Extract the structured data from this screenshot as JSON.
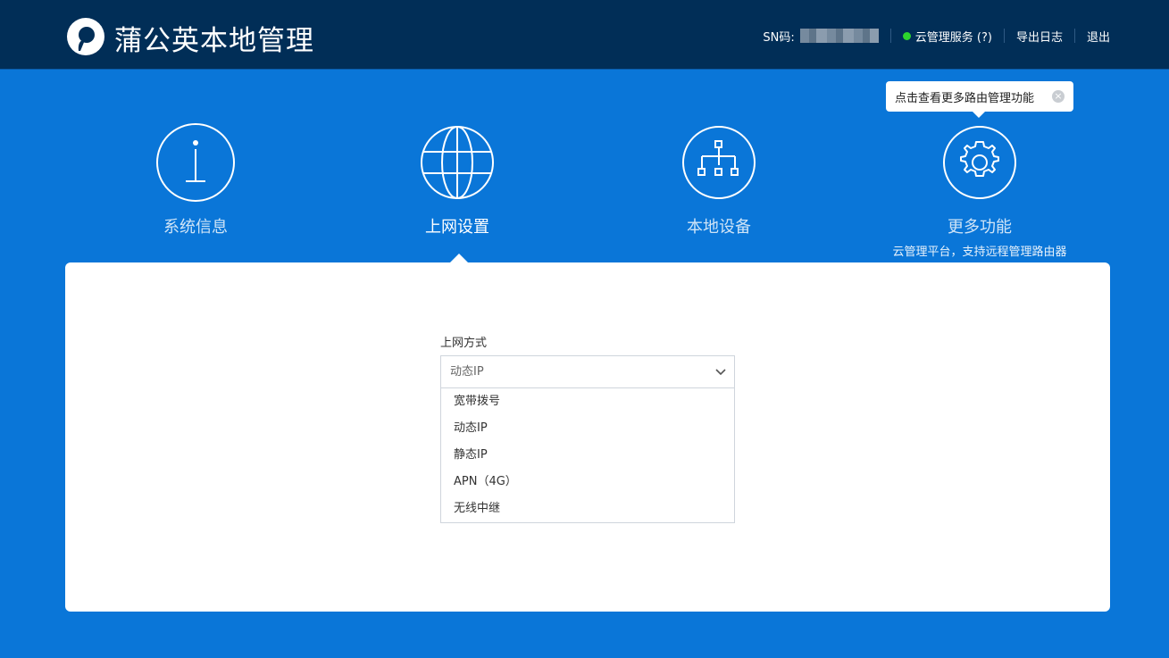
{
  "header": {
    "brand": "蒲公英本地管理",
    "sn_label": "SN码:",
    "cloud_service": "云管理服务 (?)",
    "export_log": "导出日志",
    "logout": "退出",
    "status_color": "#2dd42d"
  },
  "tooltip": {
    "text": "点击查看更多路由管理功能",
    "close_icon": "close-icon"
  },
  "nav": {
    "items": [
      {
        "label": "系统信息",
        "icon": "info-icon"
      },
      {
        "label": "上网设置",
        "icon": "globe-icon",
        "active": true
      },
      {
        "label": "本地设备",
        "icon": "network-tree-icon"
      },
      {
        "label": "更多功能",
        "icon": "gear-icon",
        "sub": "云管理平台，支持远程管理路由器"
      }
    ]
  },
  "form": {
    "label": "上网方式",
    "selected": "动态IP",
    "options": [
      "宽带拨号",
      "动态IP",
      "静态IP",
      "APN（4G）",
      "无线中继"
    ]
  },
  "colors": {
    "header_bg": "#012e57",
    "page_bg": "#0a76d8"
  }
}
